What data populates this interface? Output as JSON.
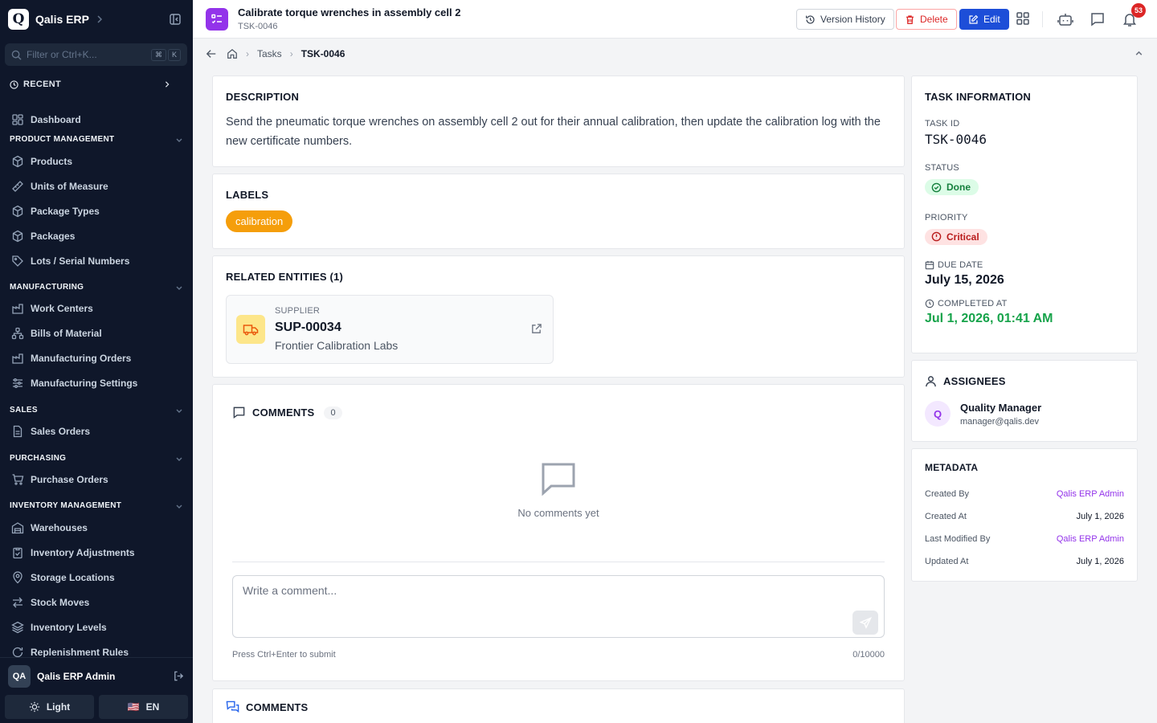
{
  "app": {
    "brand": "Qalis ERP",
    "logo_letter": "Q"
  },
  "sidebar": {
    "filter_placeholder": "Filter or Ctrl+K...",
    "kbd": [
      "⌘",
      "K"
    ],
    "recent_label": "RECENT",
    "dashboard": "Dashboard",
    "sections": [
      {
        "title": "PRODUCT MANAGEMENT",
        "items": [
          "Products",
          "Units of Measure",
          "Package Types",
          "Packages",
          "Lots / Serial Numbers"
        ]
      },
      {
        "title": "MANUFACTURING",
        "items": [
          "Work Centers",
          "Bills of Material",
          "Manufacturing Orders",
          "Manufacturing Settings"
        ]
      },
      {
        "title": "SALES",
        "items": [
          "Sales Orders"
        ]
      },
      {
        "title": "PURCHASING",
        "items": [
          "Purchase Orders"
        ]
      },
      {
        "title": "INVENTORY MANAGEMENT",
        "items": [
          "Warehouses",
          "Inventory Adjustments",
          "Storage Locations",
          "Stock Moves",
          "Inventory Levels",
          "Replenishment Rules"
        ]
      }
    ],
    "user": {
      "initials": "QA",
      "name": "Qalis ERP Admin"
    },
    "theme_label": "Light",
    "lang_flag": "🇺🇸",
    "lang_label": "EN"
  },
  "header": {
    "title": "Calibrate torque wrenches in assembly cell 2",
    "subtitle": "TSK-0046",
    "version_history": "Version History",
    "delete": "Delete",
    "edit": "Edit",
    "notification_count": "53"
  },
  "breadcrumb": {
    "tasks": "Tasks",
    "current": "TSK-0046"
  },
  "description": {
    "title": "DESCRIPTION",
    "text": "Send the pneumatic torque wrenches on assembly cell 2 out for their annual calibration, then update the calibration log with the new certificate numbers."
  },
  "labels": {
    "title": "LABELS",
    "items": [
      "calibration"
    ],
    "color": "#f59e0b"
  },
  "related": {
    "title": "RELATED ENTITIES (1)",
    "entity": {
      "type": "SUPPLIER",
      "id": "SUP-00034",
      "name": "Frontier Calibration Labs"
    }
  },
  "comments": {
    "title": "COMMENTS",
    "count": "0",
    "empty_text": "No comments yet",
    "placeholder": "Write a comment...",
    "hint": "Press Ctrl+Enter to submit",
    "char_count": "0/10000",
    "second_title": "COMMENTS"
  },
  "task_info": {
    "title": "TASK INFORMATION",
    "id_label": "TASK ID",
    "id": "TSK-0046",
    "status_label": "STATUS",
    "status": "Done",
    "priority_label": "PRIORITY",
    "priority": "Critical",
    "due_label": "DUE DATE",
    "due": "July 15, 2026",
    "completed_label": "COMPLETED AT",
    "completed": "Jul 1, 2026, 01:41 AM"
  },
  "assignees": {
    "title": "ASSIGNEES",
    "items": [
      {
        "initial": "Q",
        "name": "Quality Manager",
        "email": "manager@qalis.dev"
      }
    ]
  },
  "metadata": {
    "title": "METADATA",
    "created_by_label": "Created By",
    "created_by": "Qalis ERP Admin",
    "created_at_label": "Created At",
    "created_at": "July 1, 2026",
    "modified_by_label": "Last Modified By",
    "modified_by": "Qalis ERP Admin",
    "updated_at_label": "Updated At",
    "updated_at": "July 1, 2026"
  },
  "colors": {
    "accent": "#1d4ed8",
    "brand_purple": "#9333ea",
    "danger": "#dc2626",
    "success": "#16a34a",
    "sidebar_bg": "#0f172a"
  }
}
